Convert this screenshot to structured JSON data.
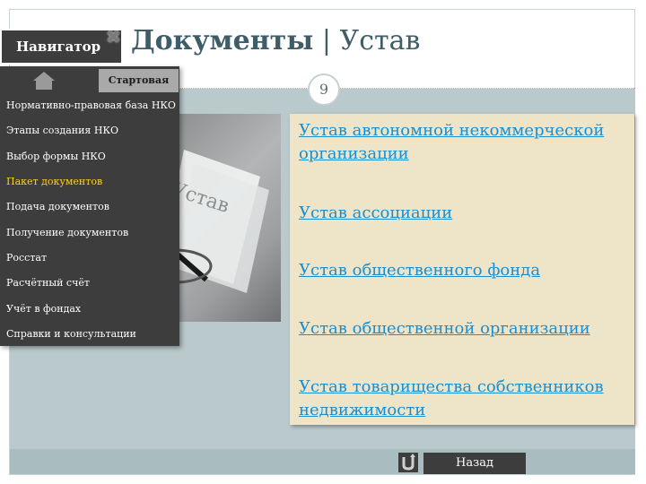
{
  "header": {
    "title": "Документы",
    "separator": "|",
    "subtitle": "Устав",
    "page_number": "9"
  },
  "navigator": {
    "tab_label": "Навигатор",
    "start_label": "Стартовая",
    "home_icon": "home-icon",
    "close_icon": "close-icon",
    "items": [
      {
        "label": "Нормативно-правовая база НКО"
      },
      {
        "label": "Этапы создания НКО"
      },
      {
        "label": "Выбор формы НКО"
      },
      {
        "label": "Пакет документов",
        "active": true
      },
      {
        "label": "Подача документов"
      },
      {
        "label": "Получение документов"
      },
      {
        "label": "Росстат"
      },
      {
        "label": "Расчётный счёт"
      },
      {
        "label": "Учёт в фондах"
      },
      {
        "label": "Справки и консультации"
      }
    ]
  },
  "photo": {
    "stamp_text": "Устав"
  },
  "links": [
    {
      "label": "Устав автономной некоммерческой организации"
    },
    {
      "label": "Устав ассоциации"
    },
    {
      "label": "Устав общественного фонда"
    },
    {
      "label": "Устав общественной организации"
    },
    {
      "label": "Устав товарищества собственников недвижимости"
    }
  ],
  "footer": {
    "back_label": "Назад",
    "back_icon": "return-icon"
  },
  "colors": {
    "title": "#3f5d68",
    "menu_bg": "#3d3d3d",
    "active_item": "#ffd21f",
    "link": "#1b8fd0",
    "panel_bg": "#eee4c8",
    "main_bg": "#b9c9cc"
  }
}
